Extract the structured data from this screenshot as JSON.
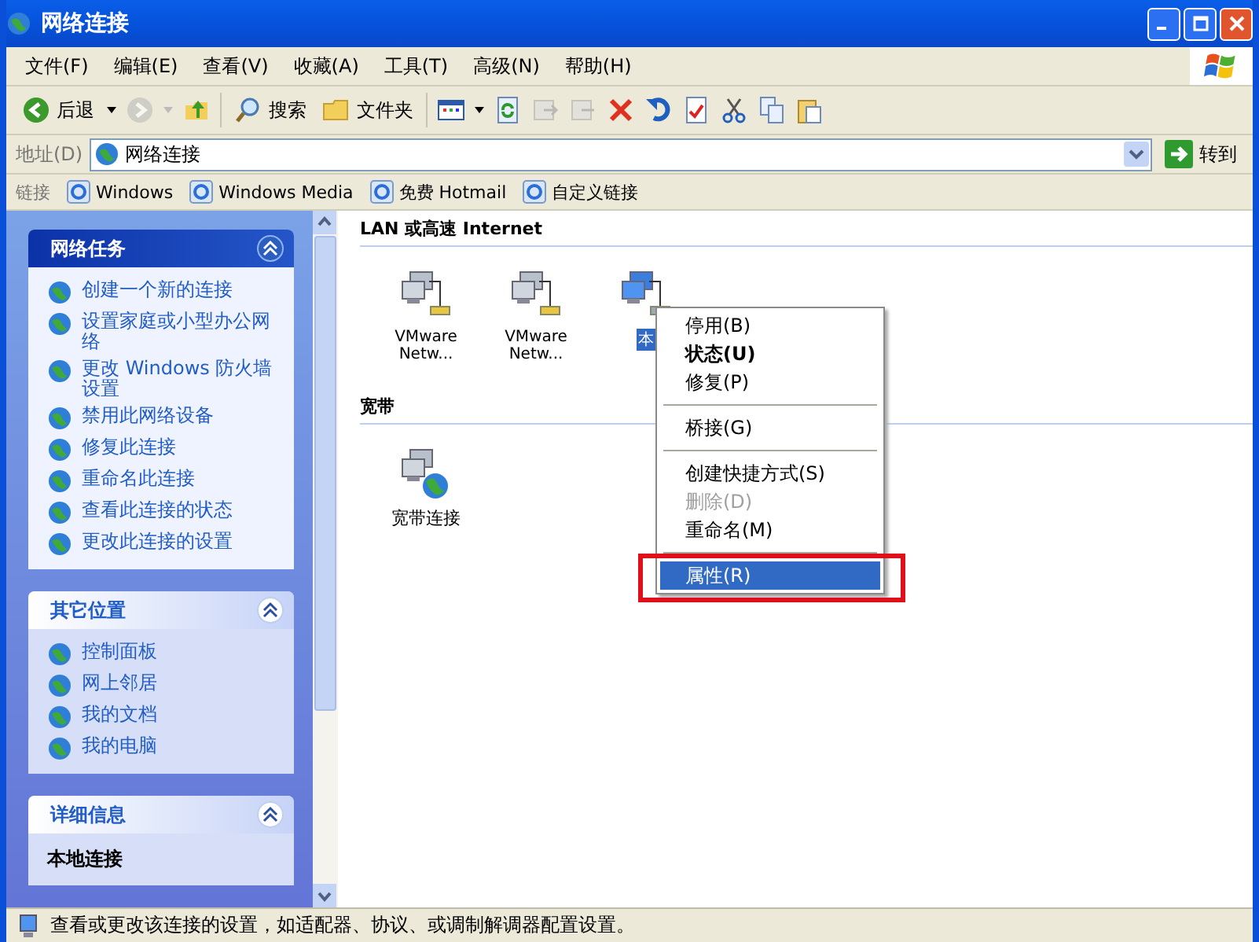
{
  "window": {
    "title": "网络连接"
  },
  "menu_bar": [
    "文件(F)",
    "编辑(E)",
    "查看(V)",
    "收藏(A)",
    "工具(T)",
    "高级(N)",
    "帮助(H)"
  ],
  "toolbar": {
    "back": "后退",
    "search": "搜索",
    "folders": "文件夹"
  },
  "address_bar": {
    "label": "地址(D)",
    "value": "网络连接",
    "go": "转到"
  },
  "links_bar": {
    "label": "链接",
    "links": [
      "Windows",
      "Windows Media",
      "免费 Hotmail",
      "自定义链接"
    ]
  },
  "task_pane": [
    {
      "title": "网络任务",
      "expanded": true,
      "items": [
        "创建一个新的连接",
        "设置家庭或小型办公网络",
        "更改 Windows 防火墙设置",
        "禁用此网络设备",
        "修复此连接",
        "重命名此连接",
        "查看此连接的状态",
        "更改此连接的设置"
      ]
    },
    {
      "title": "其它位置",
      "expanded": true,
      "items": [
        "控制面板",
        "网上邻居",
        "我的文档",
        "我的电脑"
      ]
    },
    {
      "title": "详细信息",
      "expanded": true,
      "heading": "本地连接"
    }
  ],
  "groups": [
    {
      "title": "LAN 或高速 Internet",
      "items": [
        {
          "label": "VMware Netw...",
          "kind": "lan",
          "selected": false
        },
        {
          "label": "VMware Netw...",
          "kind": "lan",
          "selected": false
        },
        {
          "label": "本",
          "kind": "lan-active",
          "selected": true
        }
      ]
    },
    {
      "title": "宽带",
      "items": [
        {
          "label": "宽带连接",
          "kind": "broadband",
          "selected": false
        }
      ]
    }
  ],
  "context_menu": [
    {
      "kind": "item",
      "label": "停用(B)",
      "bold": false,
      "disabled": false,
      "selected": false
    },
    {
      "kind": "item",
      "label": "状态(U)",
      "bold": true,
      "disabled": false,
      "selected": false
    },
    {
      "kind": "item",
      "label": "修复(P)",
      "bold": false,
      "disabled": false,
      "selected": false
    },
    {
      "kind": "separator"
    },
    {
      "kind": "item",
      "label": "桥接(G)",
      "bold": false,
      "disabled": false,
      "selected": false
    },
    {
      "kind": "separator"
    },
    {
      "kind": "item",
      "label": "创建快捷方式(S)",
      "bold": false,
      "disabled": false,
      "selected": false
    },
    {
      "kind": "item",
      "label": "删除(D)",
      "bold": false,
      "disabled": true,
      "selected": false
    },
    {
      "kind": "item",
      "label": "重命名(M)",
      "bold": false,
      "disabled": false,
      "selected": false
    },
    {
      "kind": "separator"
    },
    {
      "kind": "item",
      "label": "属性(R)",
      "bold": false,
      "disabled": false,
      "selected": true,
      "highlighted": true
    }
  ],
  "status_bar": "查看或更改该连接的设置，如适配器、协议、或调制解调器配置设置。"
}
